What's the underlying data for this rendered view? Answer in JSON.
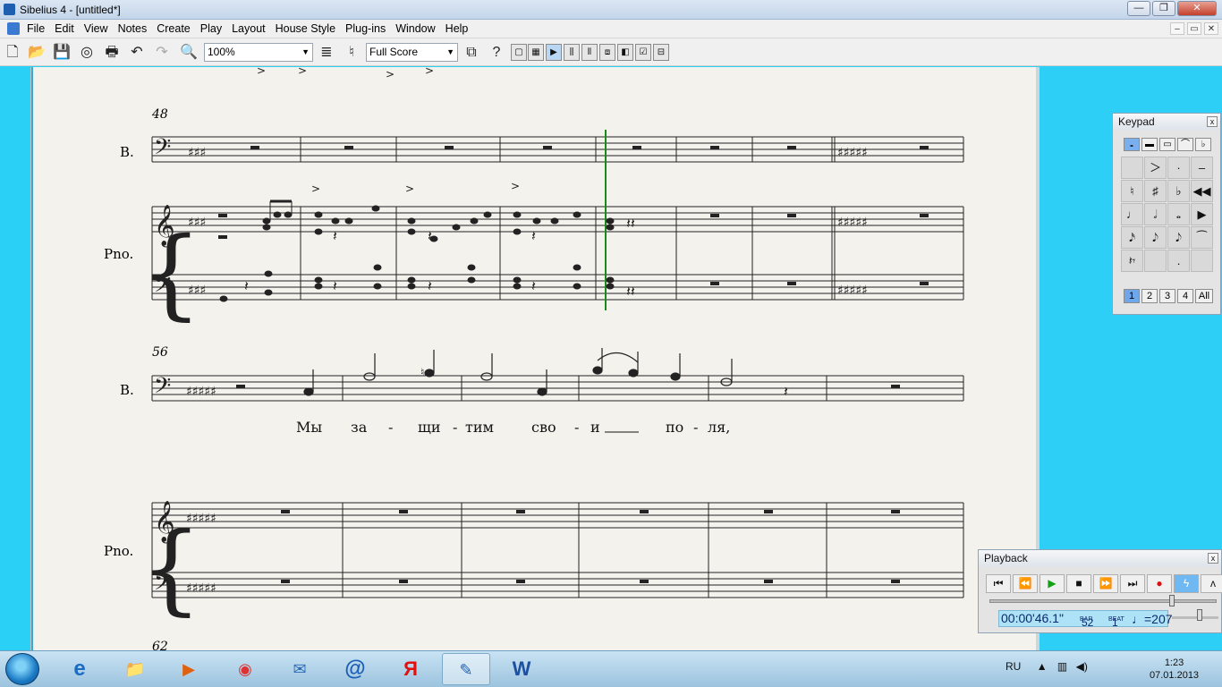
{
  "window": {
    "title": "Sibelius 4 - [untitled*]",
    "minimize": "—",
    "maximize": "❐",
    "close": "✕"
  },
  "menu": [
    "File",
    "Edit",
    "View",
    "Notes",
    "Create",
    "Play",
    "Layout",
    "House Style",
    "Plug-ins",
    "Window",
    "Help"
  ],
  "mdi": {
    "minimize": "–",
    "restore": "▭",
    "close": "✕"
  },
  "toolbar": {
    "zoom": "100%",
    "score_view": "Full Score"
  },
  "score": {
    "systems": [
      {
        "bar_number": "48",
        "instruments": [
          "B.",
          "Pno."
        ]
      },
      {
        "bar_number": "56",
        "instruments": [
          "B.",
          "Pno."
        ],
        "lyrics": [
          "Мы",
          "за",
          "-",
          "щи",
          "-",
          "тим",
          "сво",
          "-",
          "и",
          "по",
          "-",
          "ля,"
        ]
      },
      {
        "bar_number": "62"
      }
    ],
    "colors": {
      "paper": "#f4f2ed",
      "playback_line": "#1a8a1a"
    }
  },
  "keypad": {
    "title": "Keypad",
    "close": "x",
    "tabs": [
      "𝅝",
      "▬",
      "▭",
      "⌒",
      "♭"
    ],
    "keys": [
      "",
      "＞",
      "·",
      "–",
      "♮",
      "♯",
      "♭",
      "◀◀",
      "♩",
      "𝅗𝅥",
      "𝅝",
      "▶",
      "𝅘𝅥𝅯",
      "𝅘𝅥𝅮",
      "𝅘𝅥𝅮",
      "⁀",
      "𝄽𝄾",
      "",
      ".",
      ""
    ],
    "layouts": [
      "1",
      "2",
      "3",
      "4",
      "All"
    ]
  },
  "playback": {
    "title": "Playback",
    "close": "x",
    "time": "00:00'46.1\"",
    "bar_label": "BAR",
    "bar": "52",
    "beat_label": "BEAT",
    "beat": "1",
    "tempo": "♩=207",
    "position_fraction": 0.81
  },
  "taskbar": {
    "apps": [
      "e",
      "📁",
      "▶",
      "◉",
      "✉",
      "@",
      "Я",
      "✎",
      "W"
    ],
    "language": "RU",
    "time": "1:23",
    "date": "07.01.2013"
  }
}
